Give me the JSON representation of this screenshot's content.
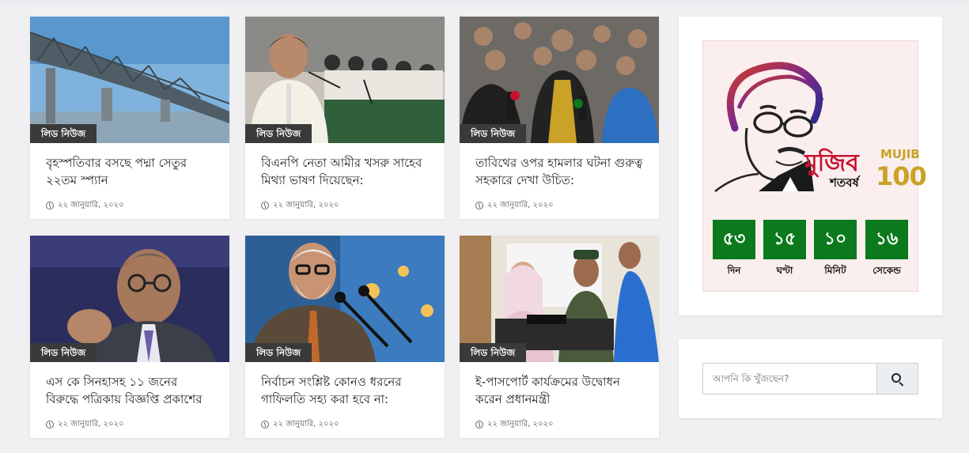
{
  "news": [
    {
      "category": "লিড নিউজ",
      "title": "বৃহস্পতিবার বসছে পদ্মা সেতুর ২২তম স্প্যান",
      "date": "২২ জানুয়ারি, ২০২০",
      "image": "padma-bridge-photo"
    },
    {
      "category": "লিড নিউজ",
      "title": "বিএনপি নেতা আমীর খসরু সাহেব মিথ্যা ভাষণ দিয়েছেন:",
      "date": "২২ জানুয়ারি, ২০২০",
      "image": "minister-speech-photo"
    },
    {
      "category": "লিড নিউজ",
      "title": "তাবিথের ওপর হামলার ঘটনা গুরুত্ব সহকারে দেখা উচিত:",
      "date": "২২ জানুয়ারি, ২০২০",
      "image": "press-crowd-photo"
    },
    {
      "category": "লিড নিউজ",
      "title": "এস কে সিনহাসহ ১১ জনের বিরুদ্ধে পত্রিকায় বিজ্ঞপ্তি প্রকাশের",
      "date": "২২ জানুয়ারি, ২০২০",
      "image": "sk-sinha-photo"
    },
    {
      "category": "লিড নিউজ",
      "title": "নির্বাচন সংশ্লিষ্ট কোনও ধরনের গাফিলতি সহ্য করা হবে না:",
      "date": "২২ জানুয়ারি, ২০২০",
      "image": "election-commissioner-photo"
    },
    {
      "category": "লিড নিউজ",
      "title": "ই-পাসপোর্ট কার্যক্রমের উদ্বোধন করেন প্রধানমন্ত্রী",
      "date": "২২ জানুয়ারি, ২০২০",
      "image": "e-passport-photo"
    }
  ],
  "mujib": {
    "logo_bn": "মুজিব",
    "logo_bn_sub": "শতবর্ষ",
    "logo_en": "MUJIB",
    "logo_num": "100",
    "countdown": [
      {
        "value": "৫৩",
        "label": "দিন"
      },
      {
        "value": "১৫",
        "label": "ঘণ্টা"
      },
      {
        "value": "১০",
        "label": "মিনিট"
      },
      {
        "value": "১৬",
        "label": "সেকেন্ড"
      }
    ]
  },
  "search": {
    "placeholder": "আপনি কি খুঁজছেন?"
  },
  "colors": {
    "countdown_bg": "#0b7a1c",
    "badge_bg": "#3a3a3a",
    "logo_red": "#c8102e",
    "logo_gold": "#c9a227"
  }
}
